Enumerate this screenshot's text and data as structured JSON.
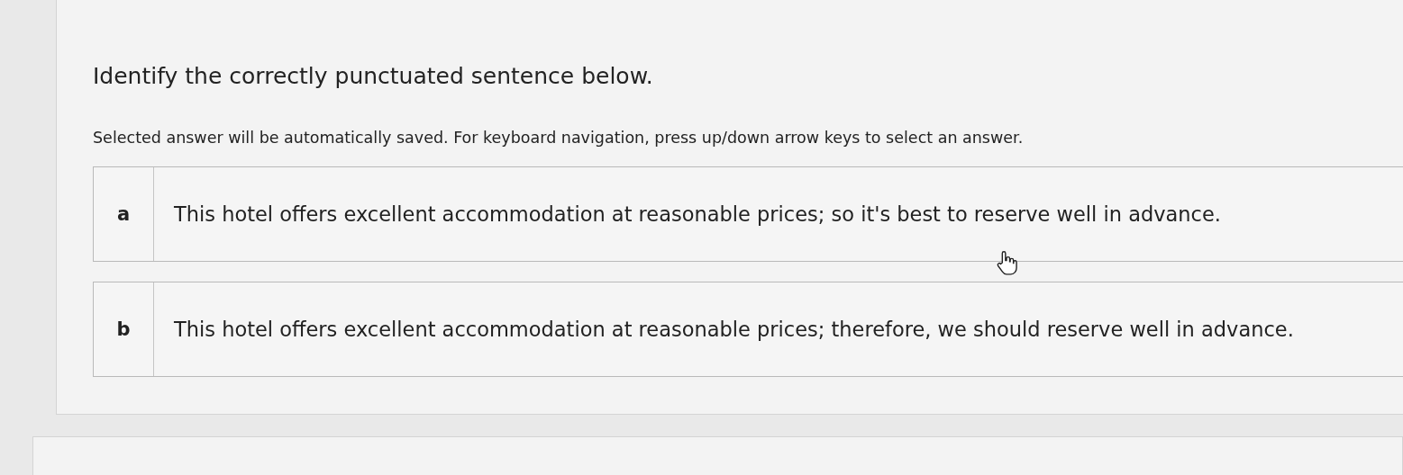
{
  "question": {
    "prompt": "Identify the correctly punctuated sentence below.",
    "instructions": "Selected answer will be automatically saved. For keyboard navigation, press up/down arrow keys to select an answer.",
    "options": [
      {
        "letter": "a",
        "text": "This hotel offers excellent accommodation at reasonable prices; so it's best to reserve well in advance.",
        "selected": false
      },
      {
        "letter": "b",
        "text": "This hotel offers excellent accommodation at reasonable prices; therefore, we should reserve well in advance.",
        "selected": false
      }
    ]
  }
}
